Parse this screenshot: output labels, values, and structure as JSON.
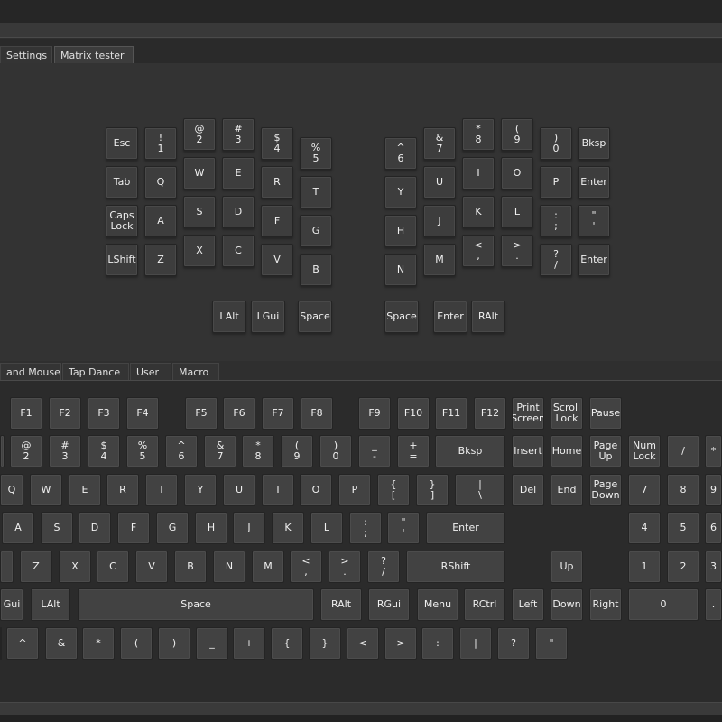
{
  "top_tabs": [
    "Settings",
    "Matrix tester"
  ],
  "top_tabs_selected": "Matrix tester",
  "bottom_tabs": [
    "and Mouse",
    "Tap Dance",
    "User",
    "Macro"
  ],
  "split_keyboard": {
    "left": [
      [
        "Esc",
        "Tab",
        "Caps\nLock",
        "LShift"
      ],
      [
        "!\n1",
        "Q",
        "A",
        "Z"
      ],
      [
        "@\n2",
        "W",
        "S",
        "X"
      ],
      [
        "#\n3",
        "E",
        "D",
        "C"
      ],
      [
        "$\n4",
        "R",
        "F",
        "V"
      ],
      [
        "%\n5",
        "T",
        "G",
        "B"
      ]
    ],
    "left_thumb": [
      "LAlt",
      "LGui",
      "Space"
    ],
    "right": [
      [
        "^\n6",
        "Y",
        "H",
        "N"
      ],
      [
        "&\n7",
        "U",
        "J",
        "M"
      ],
      [
        "*\n8",
        "I",
        "K",
        "<\n,"
      ],
      [
        "(\n9",
        "O",
        "L",
        ">\n."
      ],
      [
        ")\n0",
        "P",
        ":\n;",
        "?\n/"
      ],
      [
        "Bksp",
        "Enter",
        "\"\n'",
        "Enter"
      ]
    ],
    "right_thumb": [
      "Space",
      "Enter",
      "RAlt"
    ]
  },
  "keycode_keyboard": {
    "rows": [
      [
        "F1",
        "F2",
        "F3",
        "F4",
        "F5",
        "F6",
        "F7",
        "F8",
        "F9",
        "F10",
        "F11",
        "F12",
        "Print\nScreen",
        "Scroll\nLock",
        "Pause"
      ],
      [
        "",
        "@\n2",
        "#\n3",
        "$\n4",
        "%\n5",
        "^\n6",
        "&\n7",
        "*\n8",
        "(\n9",
        ")\n0",
        "_\n-",
        "+\n=",
        "Bksp",
        "Insert",
        "Home",
        "Page\nUp",
        "Num\nLock",
        "/",
        "*"
      ],
      [
        "Q",
        "W",
        "E",
        "R",
        "T",
        "Y",
        "U",
        "I",
        "O",
        "P",
        "{\n[",
        "}\n]",
        "|\n\\",
        "Del",
        "End",
        "Page\nDown",
        "7",
        "8",
        "9"
      ],
      [
        "",
        "A",
        "S",
        "D",
        "F",
        "G",
        "H",
        "J",
        "K",
        "L",
        ":\n;",
        "\"\n'",
        "Enter",
        "4",
        "5",
        "6"
      ],
      [
        "",
        "Z",
        "X",
        "C",
        "V",
        "B",
        "N",
        "M",
        "<\n,",
        ">\n.",
        "?\n/",
        "RShift",
        "Up",
        "1",
        "2",
        "3"
      ],
      [
        "Gui",
        "LAlt",
        "Space",
        "RAlt",
        "RGui",
        "Menu",
        "RCtrl",
        "Left",
        "Down",
        "Right",
        "0",
        "."
      ],
      [
        "",
        "^",
        "&",
        "*",
        "(",
        ")",
        "_",
        "+",
        "{",
        "}",
        "<",
        ">",
        ":",
        "|",
        "?",
        "\""
      ]
    ]
  }
}
